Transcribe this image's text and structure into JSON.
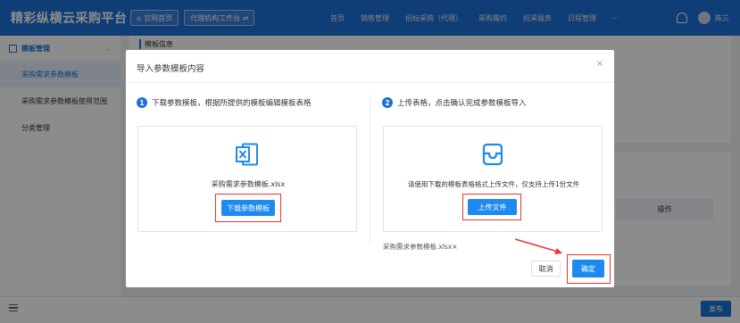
{
  "topbar": {
    "brand": "精彩纵横云采购平台",
    "home_btn": "官网首页",
    "agency_btn": "代理机构工作台 ⇌",
    "nav": [
      "首页",
      "销售管理",
      "招标采购（代理）",
      "采购履约",
      "招采服务",
      "日程管理",
      "···"
    ],
    "username": "陈三"
  },
  "sidebar": {
    "group": "模板管理",
    "items": [
      {
        "label": "采购需求参数模板",
        "active": true
      },
      {
        "label": "采购需求参数模板使用范围",
        "active": false
      },
      {
        "label": "分类管理",
        "active": false
      }
    ]
  },
  "content": {
    "section_title": "模板信息",
    "table_header_action": "操作"
  },
  "bottom": {
    "publish": "发布"
  },
  "modal": {
    "title": "导入参数模板内容",
    "close": "×",
    "step1": {
      "num": "1",
      "text": "下载参数模板，根据所提供的模板编辑模板表格"
    },
    "step2": {
      "num": "2",
      "text": "上传表格，点击确认完成参数模板导入"
    },
    "template_file": "采购需求参数模板.xlsx",
    "download_btn": "下载参数模板",
    "upload_hint": "请使用下载的模板表格格式上传文件，仅支持上传1份文件",
    "upload_btn": "上传文件",
    "uploaded_file": "采购需求参数模板.xlsx×",
    "cancel": "取消",
    "confirm": "确定"
  },
  "colors": {
    "primary": "#1d6fd6",
    "button": "#1d8af0",
    "highlight": "#e33"
  },
  "icons": [
    "excel-file-icon",
    "inbox-icon",
    "bell-icon",
    "menu-icon",
    "close-icon"
  ]
}
